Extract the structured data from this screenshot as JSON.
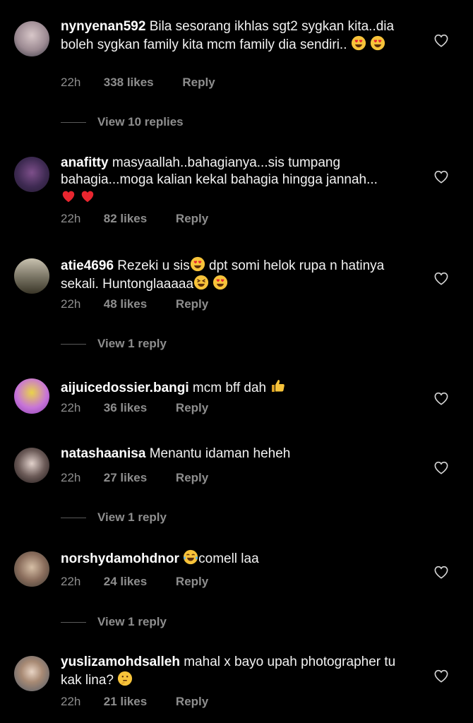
{
  "comments": [
    {
      "username": "nynyenan592",
      "text": "Bila sesorang ikhlas sgt2 sygkan kita..dia boleh sygkan family kita mcm family dia sendiri..",
      "emojis": [
        "heart-eyes",
        "heart-eyes"
      ],
      "time": "22h",
      "likes": "338 likes",
      "reply": "Reply",
      "view_replies": "View 10 replies"
    },
    {
      "username": "anafitty",
      "text": "masyaallah..bahagianya...sis tumpang bahagia...moga kalian kekal bahagia hingga jannah...",
      "emojis": [
        "red-heart",
        "red-heart"
      ],
      "time": "22h",
      "likes": "82 likes",
      "reply": "Reply"
    },
    {
      "username": "atie4696",
      "text_a": "Rezeki u sis",
      "text_b": "dpt somi helok rupa n hatinya sekali. Huntonglaaaaa",
      "time": "22h",
      "likes": "48 likes",
      "reply": "Reply",
      "view_replies": "View 1 reply"
    },
    {
      "username": "aijuicedossier.bangi",
      "text": "mcm bff dah",
      "emojis": [
        "thumbs-up"
      ],
      "time": "22h",
      "likes": "36 likes",
      "reply": "Reply"
    },
    {
      "username": "natashaanisa",
      "text": "Menantu idaman heheh",
      "time": "22h",
      "likes": "27 likes",
      "reply": "Reply",
      "view_replies": "View 1 reply"
    },
    {
      "username": "norshydamohdnor",
      "text": "comell laa",
      "emojis": [
        "tears-of-joy"
      ],
      "time": "22h",
      "likes": "24 likes",
      "reply": "Reply",
      "view_replies": "View 1 reply"
    },
    {
      "username": "yuslizamohdsalleh",
      "text": "mahal x bayo upah photographer tu kak lina?",
      "emojis": [
        "thinking-face"
      ],
      "time": "22h",
      "likes": "21 likes",
      "reply": "Reply"
    }
  ],
  "colors": {
    "background": "#000000",
    "text": "#ffffff",
    "muted": "#8e8e8e",
    "emoji": "#f7c33a",
    "heart": "#e8262f"
  }
}
